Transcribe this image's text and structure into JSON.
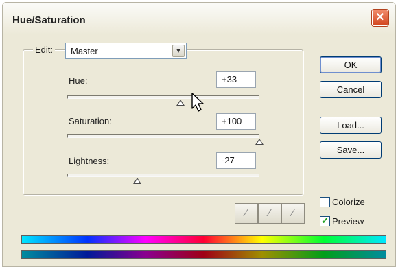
{
  "window": {
    "title": "Hue/Saturation"
  },
  "edit": {
    "label": "Edit:",
    "selected": "Master"
  },
  "sliders": {
    "hue": {
      "label": "Hue:",
      "value": "+33",
      "level": 0.59
    },
    "saturation": {
      "label": "Saturation:",
      "value": "+100",
      "level": 1.0
    },
    "lightness": {
      "label": "Lightness:",
      "value": "-27",
      "level": 0.365
    }
  },
  "buttons": {
    "ok": "OK",
    "cancel": "Cancel",
    "load": "Load...",
    "save": "Save..."
  },
  "options": {
    "colorize": {
      "label": "Colorize",
      "checked": false
    },
    "preview": {
      "label": "Preview",
      "checked": true
    }
  },
  "icons": {
    "close": "close-icon",
    "dropdown": "chevron-down-icon",
    "eyedropper": "eyedropper-icon",
    "eyedropper_plus": "eyedropper-plus-icon",
    "eyedropper_minus": "eyedropper-minus-icon",
    "cursor": "mouse-cursor-icon"
  },
  "colors": {
    "accent": "#003c74",
    "close": "#d2451e",
    "check": "#21a121"
  }
}
